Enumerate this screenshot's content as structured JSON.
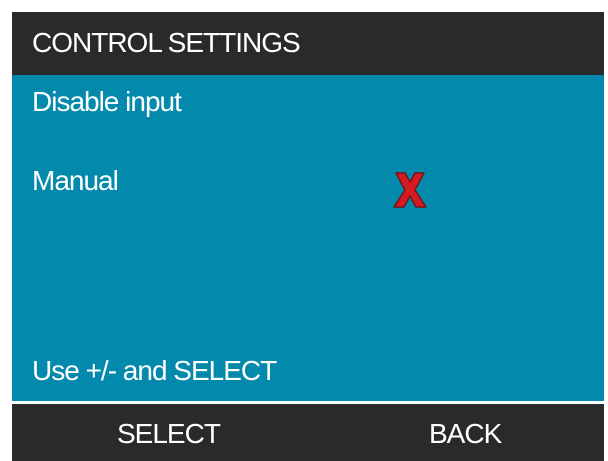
{
  "header": {
    "title": "CONTROL SETTINGS"
  },
  "screen": {
    "title_line": "Disable input",
    "manual_label": "Manual",
    "manual_status_icon": "x-mark-icon",
    "hint": "Use +/- and SELECT"
  },
  "footer": {
    "select_label": "SELECT",
    "back_label": "BACK"
  },
  "colors": {
    "header_bg": "#2b2a2a",
    "screen_bg": "#0389ac",
    "x_mark_red": "#d51b22",
    "text": "#ffffff"
  }
}
